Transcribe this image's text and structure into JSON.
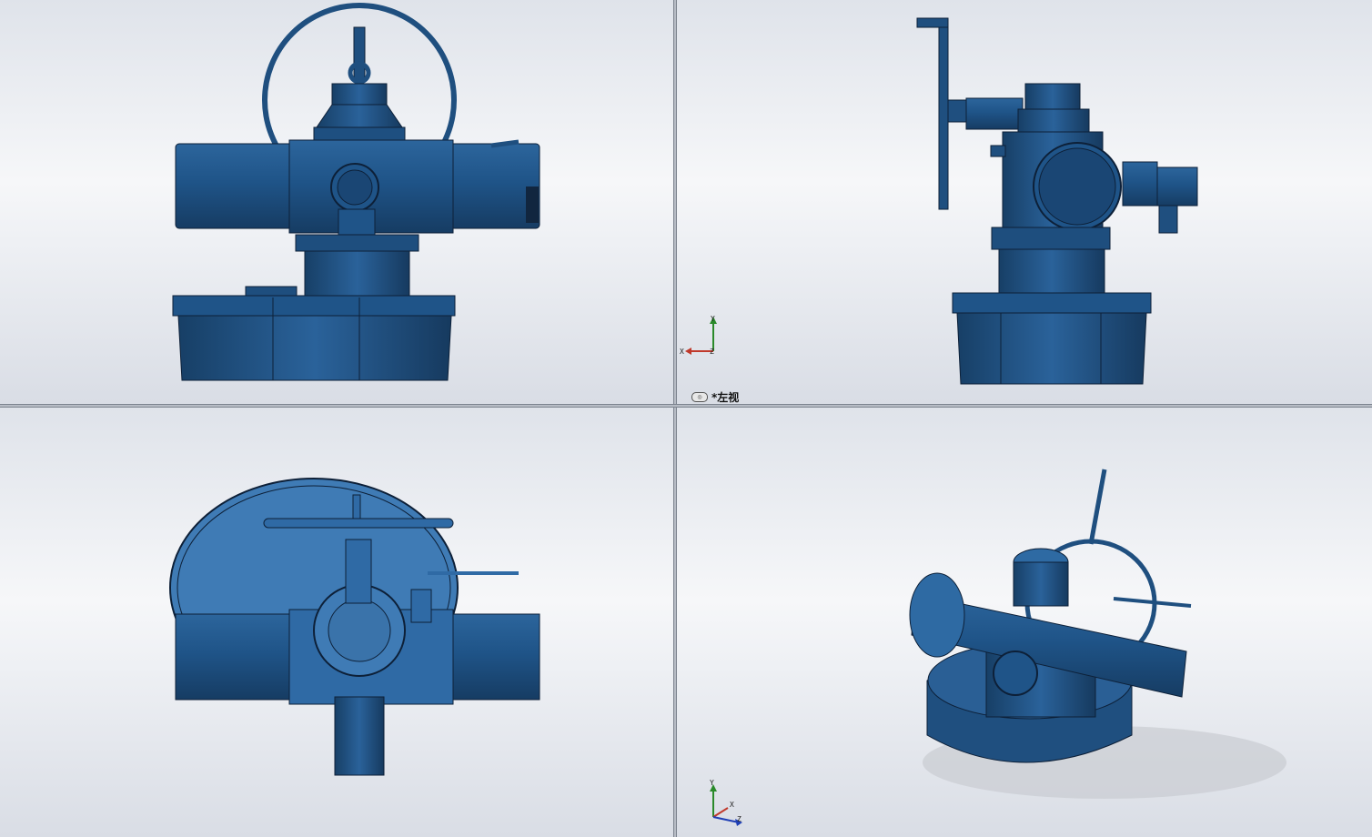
{
  "viewports": {
    "left_view": {
      "label": "*左视",
      "icon": "view-orientation-icon",
      "triad": {
        "y": "Y",
        "x": "X",
        "z": "Z"
      }
    },
    "iso_view": {
      "triad": {
        "y": "Y",
        "x": "X",
        "z": "Z"
      }
    }
  },
  "colors": {
    "body": "#1f4f7f",
    "body_dark": "#163a5f",
    "body_light": "#2e6aa3",
    "outline": "#0d2038",
    "top_view_light": "#3f7bb5"
  }
}
